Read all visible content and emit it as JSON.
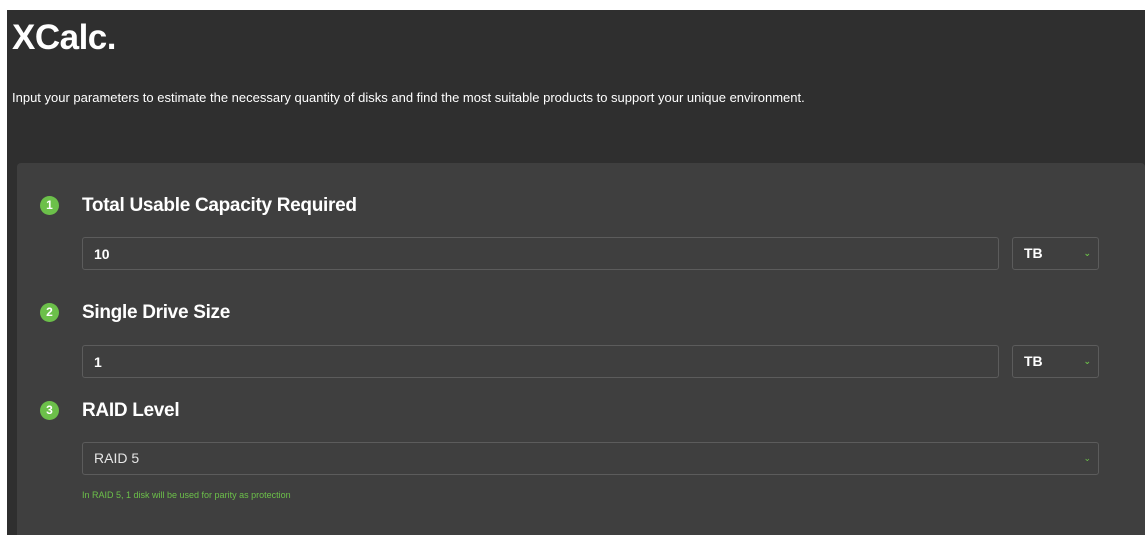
{
  "app": {
    "title": "XCalc.",
    "intro": "Input your parameters to estimate the necessary quantity of disks and find the most suitable products to support your unique environment."
  },
  "steps": [
    {
      "number": "1",
      "title": "Total Usable Capacity Required",
      "input_value": "10",
      "unit": "TB"
    },
    {
      "number": "2",
      "title": "Single Drive Size",
      "input_value": "1",
      "unit": "TB"
    },
    {
      "number": "3",
      "title": "RAID Level",
      "selected": "RAID 5",
      "hint": "In RAID 5, 1 disk will be used for parity as protection"
    }
  ],
  "icons": {
    "dropdown": "chevron-down-icon"
  },
  "colors": {
    "accent": "#6cc04a",
    "header_bg": "#2f2f2f",
    "panel_bg": "#3f3f3f",
    "text": "#ffffff"
  }
}
